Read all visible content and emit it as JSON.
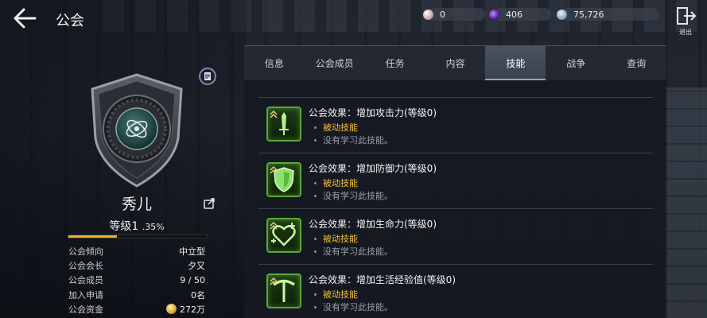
{
  "header": {
    "title": "公会",
    "exit_label": "退出"
  },
  "currencies": [
    {
      "icon": "pearl-icon",
      "value": "0"
    },
    {
      "icon": "dark-orb-icon",
      "value": "406"
    },
    {
      "icon": "crystal-icon",
      "value": "75,726"
    }
  ],
  "guild": {
    "name": "秀儿",
    "level_label": "等级1",
    "level_pct": ".35%",
    "xp_progress": 0.35,
    "info": [
      {
        "key": "公会倾向",
        "value": "中立型"
      },
      {
        "key": "公会会长",
        "value": "夕又"
      },
      {
        "key": "公会成员",
        "value": "9 / 50"
      },
      {
        "key": "加入申请",
        "value": "0名"
      },
      {
        "key": "公会资金",
        "value": "272万"
      }
    ]
  },
  "tabs": [
    {
      "label": "信息",
      "active": false
    },
    {
      "label": "公会成员",
      "active": false
    },
    {
      "label": "任务",
      "active": false
    },
    {
      "label": "内容",
      "active": false
    },
    {
      "label": "技能",
      "active": true
    },
    {
      "label": "战争",
      "active": false
    },
    {
      "label": "查询",
      "active": false
    }
  ],
  "skills": [
    {
      "icon": "sword-icon",
      "title": "公会效果：增加攻击力(等级0)",
      "type": "被动技能",
      "status": "没有学习此技能。"
    },
    {
      "icon": "shield-icon",
      "title": "公会效果：增加防御力(等级0)",
      "type": "被动技能",
      "status": "没有学习此技能。"
    },
    {
      "icon": "heart-plus-icon",
      "title": "公会效果：增加生命力(等级0)",
      "type": "被动技能",
      "status": "没有学习此技能。"
    },
    {
      "icon": "pickaxe-icon",
      "title": "公会效果：增加生活经验值(等级0)",
      "type": "被动技能",
      "status": "没有学习此技能。"
    }
  ],
  "colors": {
    "accent_gold": "#f2b21a",
    "skill_green": "#5aa83a",
    "skill_type_yellow": "#f0c040"
  }
}
